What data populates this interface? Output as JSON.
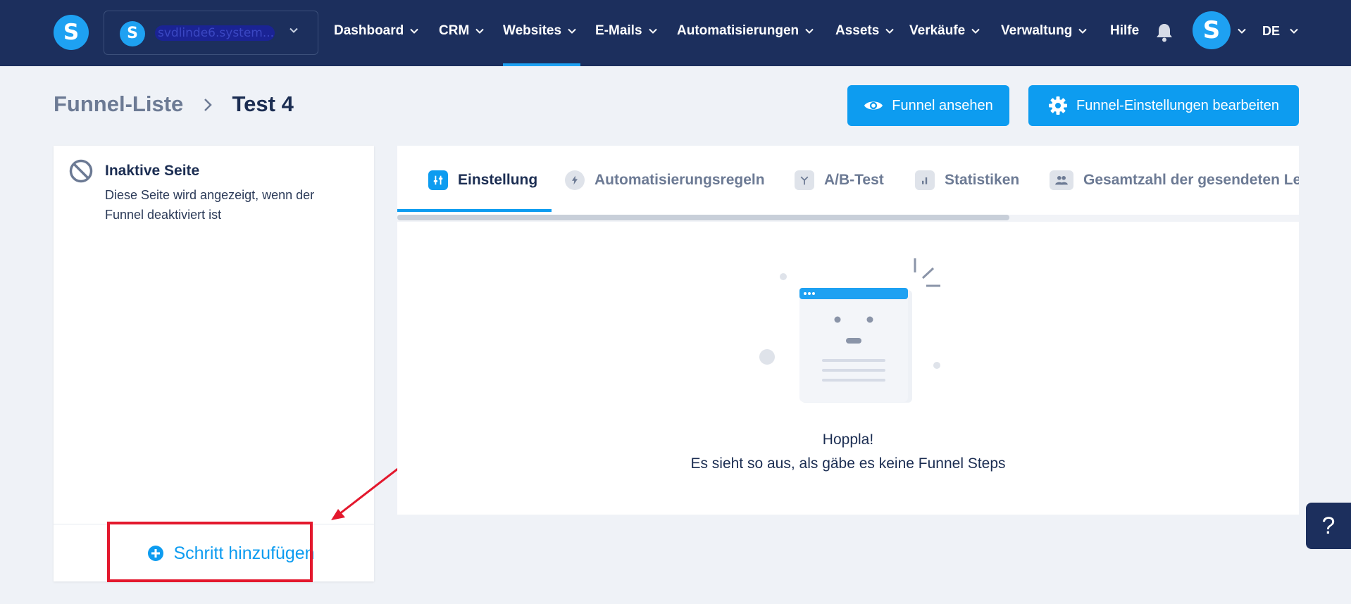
{
  "app": {
    "logo_letter": "S",
    "brand_color": "#1ea1f2",
    "nav_bg": "#1c2f5d"
  },
  "workspace": {
    "avatar_letter": "S",
    "name": "svdlinde6.system..."
  },
  "nav": {
    "items": [
      {
        "label": "Dashboard"
      },
      {
        "label": "CRM"
      },
      {
        "label": "Websites",
        "active": true
      },
      {
        "label": "E-Mails"
      },
      {
        "label": "Automatisierungen"
      },
      {
        "label": "Assets"
      },
      {
        "label": "Verkäufe"
      },
      {
        "label": "Verwaltung"
      },
      {
        "label": "Hilfe"
      }
    ],
    "bell_icon": "bell-icon",
    "user_avatar_letter": "S",
    "language": "DE"
  },
  "breadcrumb": {
    "parent": "Funnel-Liste",
    "current": "Test 4"
  },
  "actions": {
    "view_funnel": "Funnel ansehen",
    "edit_settings": "Funnel-Einstellungen bearbeiten"
  },
  "left_panel": {
    "inactive_title": "Inaktive Seite",
    "inactive_desc": "Diese Seite wird angezeigt, wenn der Funnel deaktiviert ist",
    "add_step": "Schritt hinzufügen"
  },
  "tabs": [
    {
      "label": "Einstellung",
      "icon": "sliders-icon",
      "active": true
    },
    {
      "label": "Automatisierungsregeln",
      "icon": "bolt-icon"
    },
    {
      "label": "A/B-Test",
      "icon": "split-icon"
    },
    {
      "label": "Statistiken",
      "icon": "bar-chart-icon"
    },
    {
      "label": "Gesamtzahl der gesendeten Le",
      "icon": "users-icon"
    }
  ],
  "empty_state": {
    "title": "Hoppla!",
    "subtitle": "Es sieht so aus, als gäbe es keine Funnel Steps"
  },
  "help": {
    "label": "?"
  },
  "colors": {
    "accent": "#0d9cf0",
    "highlight": "#e3182d"
  }
}
